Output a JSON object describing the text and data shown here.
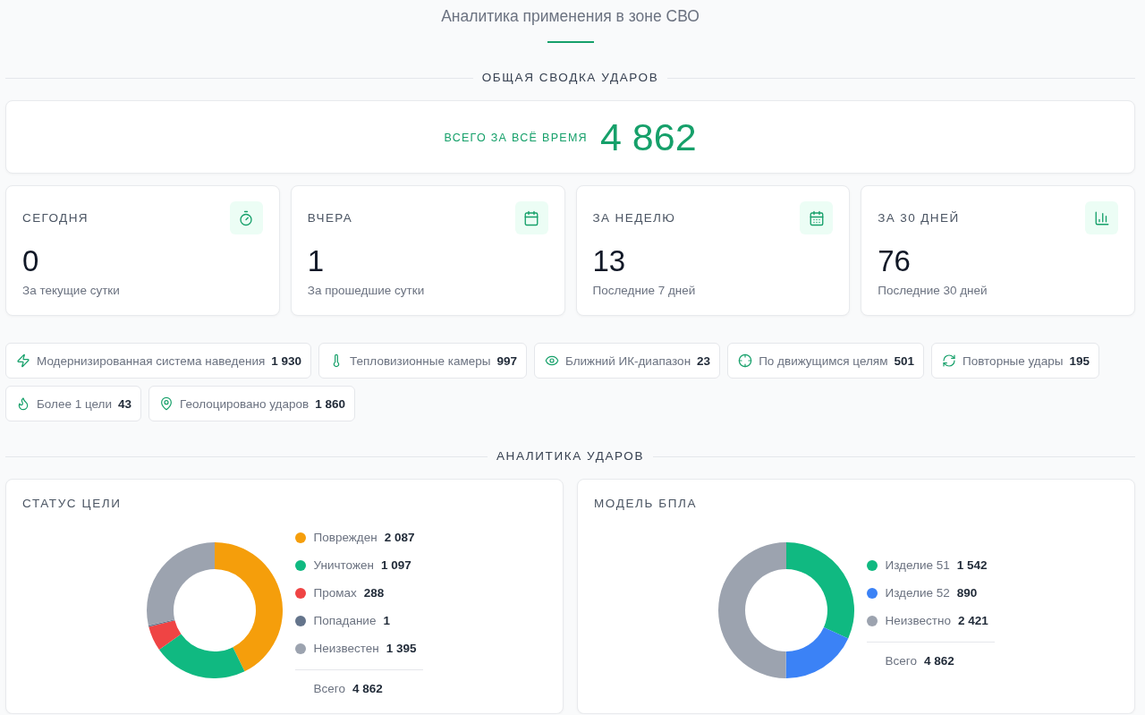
{
  "title": "Аналитика применения в зоне СВО",
  "summary": {
    "heading": "ОБЩАЯ СВОДКА УДАРОВ",
    "total": {
      "label": "ВСЕГО ЗА ВСЁ ВРЕМЯ",
      "value": "4 862"
    },
    "periods": [
      {
        "label": "СЕГОДНЯ",
        "value": "0",
        "caption": "За текущие сутки"
      },
      {
        "label": "ВЧЕРА",
        "value": "1",
        "caption": "За прошедшие сутки"
      },
      {
        "label": "ЗА НЕДЕЛЮ",
        "value": "13",
        "caption": "Последние 7 дней"
      },
      {
        "label": "ЗА 30 ДНЕЙ",
        "value": "76",
        "caption": "Последние 30 дней"
      }
    ],
    "features": [
      {
        "label": "Модернизированная система наведения",
        "count": "1 930"
      },
      {
        "label": "Тепловизионные камеры",
        "count": "997"
      },
      {
        "label": "Ближний ИК-диапазон",
        "count": "23"
      },
      {
        "label": "По движущимся целям",
        "count": "501"
      },
      {
        "label": "Повторные удары",
        "count": "195"
      },
      {
        "label": "Более 1 цели",
        "count": "43"
      },
      {
        "label": "Геолоцировано ударов",
        "count": "1 860"
      }
    ]
  },
  "analytics": {
    "heading": "АНАЛИТИКА УДАРОВ",
    "charts": [
      {
        "title": "СТАТУС ЦЕЛИ",
        "chart_data": {
          "type": "donut",
          "categories": [
            "Поврежден",
            "Уничтожен",
            "Промах",
            "Попадание",
            "Неизвестен"
          ],
          "values": [
            2087,
            1097,
            288,
            1,
            1395
          ],
          "value_labels": [
            "2 087",
            "1 097",
            "288",
            "1",
            "1 395"
          ],
          "legend": "right"
        },
        "slices": [
          {
            "color": "#f59e0b"
          },
          {
            "color": "#10b981"
          },
          {
            "color": "#ef4444"
          },
          {
            "color": "#64748b"
          },
          {
            "color": "#9ca3af"
          }
        ],
        "total": {
          "label": "Всего",
          "value": "4 862"
        }
      },
      {
        "title": "МОДЕЛЬ БПЛА",
        "chart_data": {
          "type": "donut",
          "categories": [
            "Изделие 51",
            "Изделие 52",
            "Неизвестно"
          ],
          "values": [
            1542,
            890,
            2421
          ],
          "value_labels": [
            "1 542",
            "890",
            "2 421"
          ],
          "legend": "right"
        },
        "slices": [
          {
            "color": "#10b981"
          },
          {
            "color": "#3b82f6"
          },
          {
            "color": "#9ca3af"
          }
        ],
        "total": {
          "label": "Всего",
          "value": "4 862"
        }
      }
    ]
  }
}
